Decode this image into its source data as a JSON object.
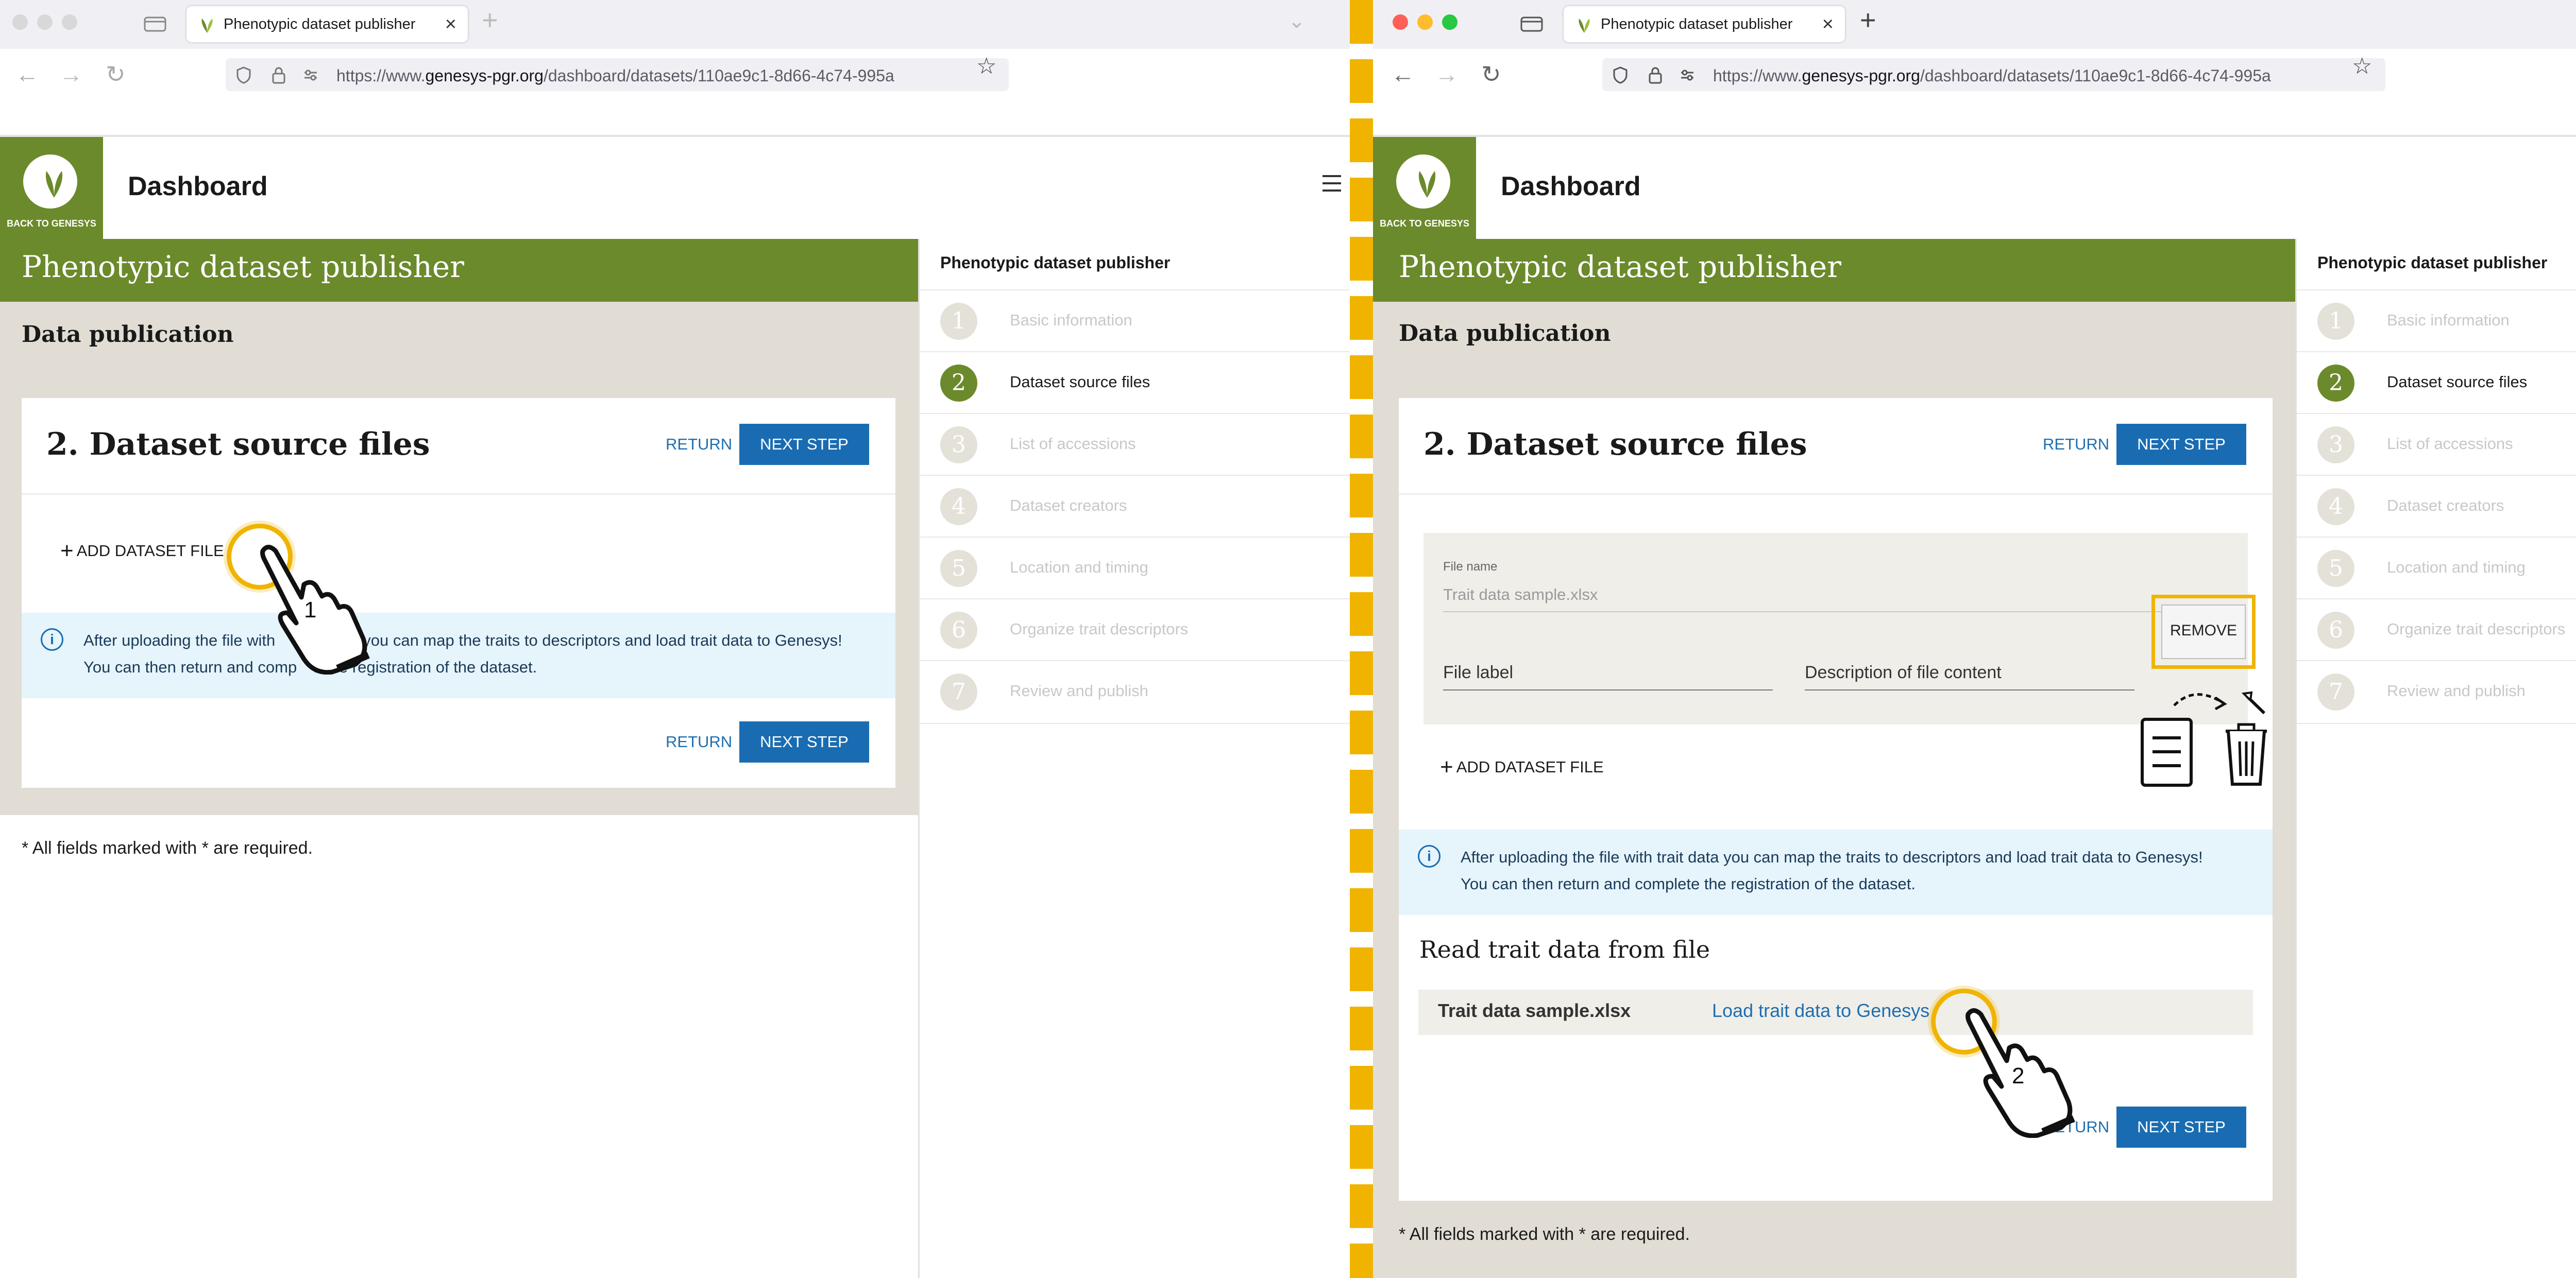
{
  "colors": {
    "olive": "#6b8a2b",
    "primary_blue": "#1a6cb2",
    "highlight": "#f0b400"
  },
  "browser": {
    "tab_title": "Phenotypic dataset publisher",
    "url_prefix": "https://www.",
    "url_domain": "genesys-pgr.org",
    "url_path": "/dashboard/datasets/110ae9c1-8d66-4c74-995a"
  },
  "header": {
    "logo_caption": "BACK TO GENESYS",
    "title": "Dashboard"
  },
  "page": {
    "banner": "Phenotypic dataset publisher",
    "section": "Data publication",
    "step_title": "2. Dataset source files",
    "return_label": "RETURN",
    "next_label": "NEXT STEP",
    "add_file_label": "ADD DATASET FILE",
    "info_line1": "After uploading the file with trait data you can map the traits to descriptors and load trait data to Genesys!",
    "info_line2": "You can then return and complete the registration of the dataset.",
    "info_left_part1": "After uploading the file with",
    "info_left_part2": "you can map the traits to descriptors and load trait data to Genesys!",
    "info_left_line2a": "You can then return and comp",
    "info_left_line2b": "e the registration of the dataset.",
    "required_note": "* All fields marked with * are required."
  },
  "file_form": {
    "file_name_label": "File name",
    "file_name_value": "Trait data sample.xlsx",
    "remove_label": "REMOVE",
    "file_label_placeholder": "File label",
    "description_placeholder": "Description of file content"
  },
  "trait_section": {
    "heading": "Read trait data from file",
    "file": "Trait data sample.xlsx",
    "load_link": "Load trait data to Genesys"
  },
  "sidebar": {
    "title": "Phenotypic dataset publisher",
    "steps": [
      {
        "num": "1",
        "label": "Basic information",
        "active": false
      },
      {
        "num": "2",
        "label": "Dataset source files",
        "active": true
      },
      {
        "num": "3",
        "label": "List of accessions",
        "active": false
      },
      {
        "num": "4",
        "label": "Dataset creators",
        "active": false
      },
      {
        "num": "5",
        "label": "Location and timing",
        "active": false
      },
      {
        "num": "6",
        "label": "Organize trait descriptors",
        "active": false
      },
      {
        "num": "7",
        "label": "Review and publish",
        "active": false
      }
    ]
  },
  "annotations": {
    "click1": "1",
    "click2": "2"
  }
}
